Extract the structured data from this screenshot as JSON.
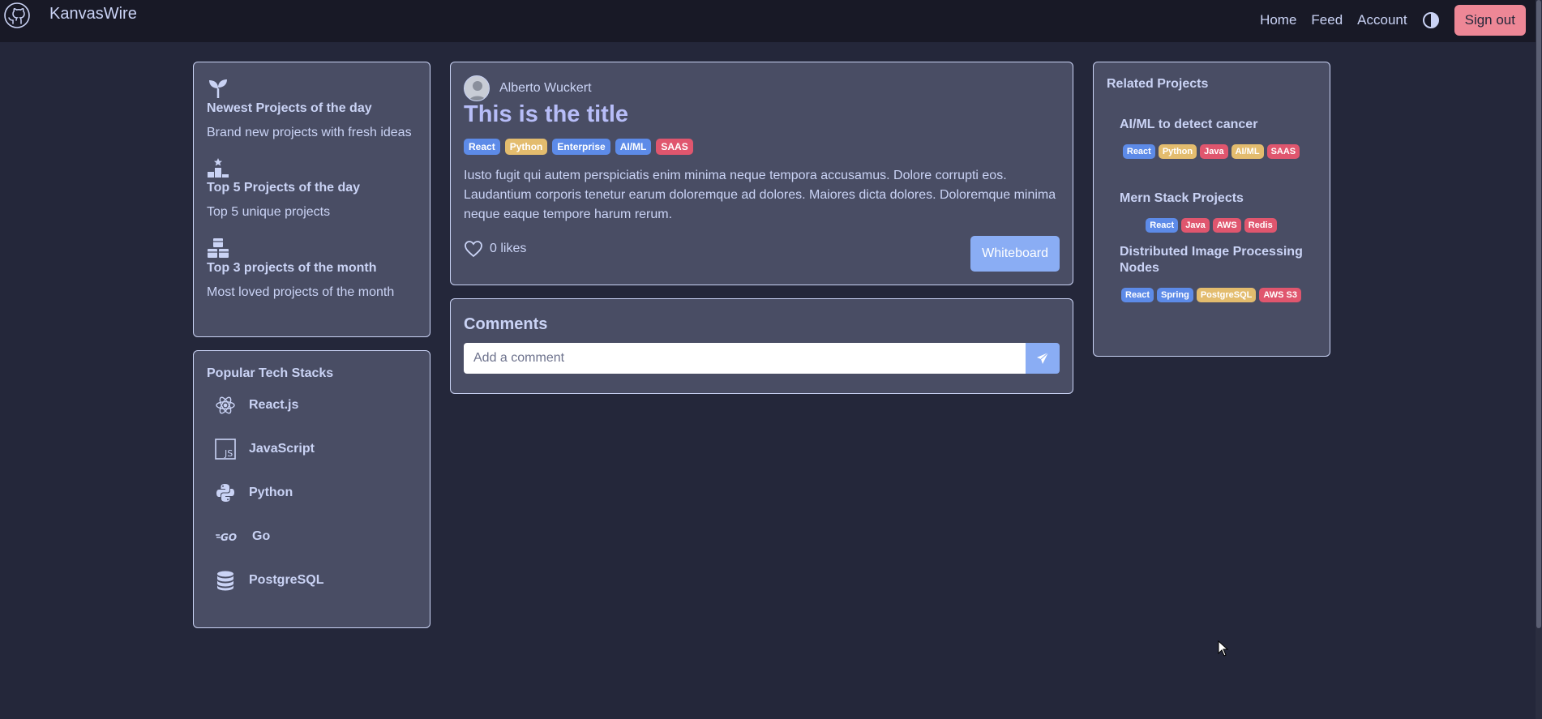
{
  "navbar": {
    "brand": "KanvasWire",
    "links": [
      "Home",
      "Feed",
      "Account"
    ],
    "signout_label": "Sign out"
  },
  "features": [
    {
      "icon": "sprout-icon",
      "title": "Newest Projects of the day",
      "desc": "Brand new projects with fresh ideas"
    },
    {
      "icon": "podium-icon",
      "title": "Top 5 Projects of the day",
      "desc": "Top 5 unique projects"
    },
    {
      "icon": "cubes-icon",
      "title": "Top 3 projects of the month",
      "desc": "Most loved projects of the month"
    }
  ],
  "tech_stacks": {
    "title": "Popular Tech Stacks",
    "items": [
      {
        "icon": "react-icon",
        "label": "React.js"
      },
      {
        "icon": "javascript-icon",
        "label": "JavaScript"
      },
      {
        "icon": "python-icon",
        "label": "Python"
      },
      {
        "icon": "go-icon",
        "label": "Go"
      },
      {
        "icon": "database-icon",
        "label": "PostgreSQL"
      }
    ]
  },
  "post": {
    "author": "Alberto Wuckert",
    "title": "This is the title",
    "tags": [
      {
        "label": "React",
        "color": "#5d8be8"
      },
      {
        "label": "Python",
        "color": "#e3bc6e"
      },
      {
        "label": "Enterprise",
        "color": "#5d8be8"
      },
      {
        "label": "AI/ML",
        "color": "#5d8be8"
      },
      {
        "label": "SAAS",
        "color": "#e0566e"
      }
    ],
    "body": "Iusto fugit qui autem perspiciatis enim minima neque tempora accusamus. Dolore corrupti eos. Laudantium corporis tenetur earum doloremque ad dolores. Maiores dicta dolores. Doloremque minima neque eaque tempore harum rerum.",
    "likes_label": "0 likes",
    "whiteboard_label": "Whiteboard"
  },
  "comments": {
    "title": "Comments",
    "placeholder": "Add a comment",
    "value": ""
  },
  "related": {
    "title": "Related Projects",
    "projects": [
      {
        "name": "AI/ML to detect cancer",
        "tags": [
          {
            "label": "React",
            "color": "#5d8be8"
          },
          {
            "label": "Python",
            "color": "#e3bc6e"
          },
          {
            "label": "Java",
            "color": "#e0566e"
          },
          {
            "label": "AI/ML",
            "color": "#e3bc6e"
          },
          {
            "label": "SAAS",
            "color": "#e0566e"
          }
        ]
      },
      {
        "name": "Mern Stack Projects",
        "tags": [
          {
            "label": "React",
            "color": "#5d8be8"
          },
          {
            "label": "Java",
            "color": "#e0566e"
          },
          {
            "label": "AWS",
            "color": "#e0566e"
          },
          {
            "label": "Redis",
            "color": "#e0566e"
          }
        ]
      },
      {
        "name": "Distributed Image Processing Nodes",
        "tags": [
          {
            "label": "React",
            "color": "#5d8be8"
          },
          {
            "label": "Spring",
            "color": "#5d8be8"
          },
          {
            "label": "PostgreSQL",
            "color": "#e3bc6e"
          },
          {
            "label": "AWS S3",
            "color": "#e0566e"
          }
        ]
      }
    ]
  },
  "colors": {
    "background": "#24273a",
    "navbar": "#181926",
    "card": "#494d64",
    "accent": "#8aadf4",
    "signout": "#ed8796"
  }
}
